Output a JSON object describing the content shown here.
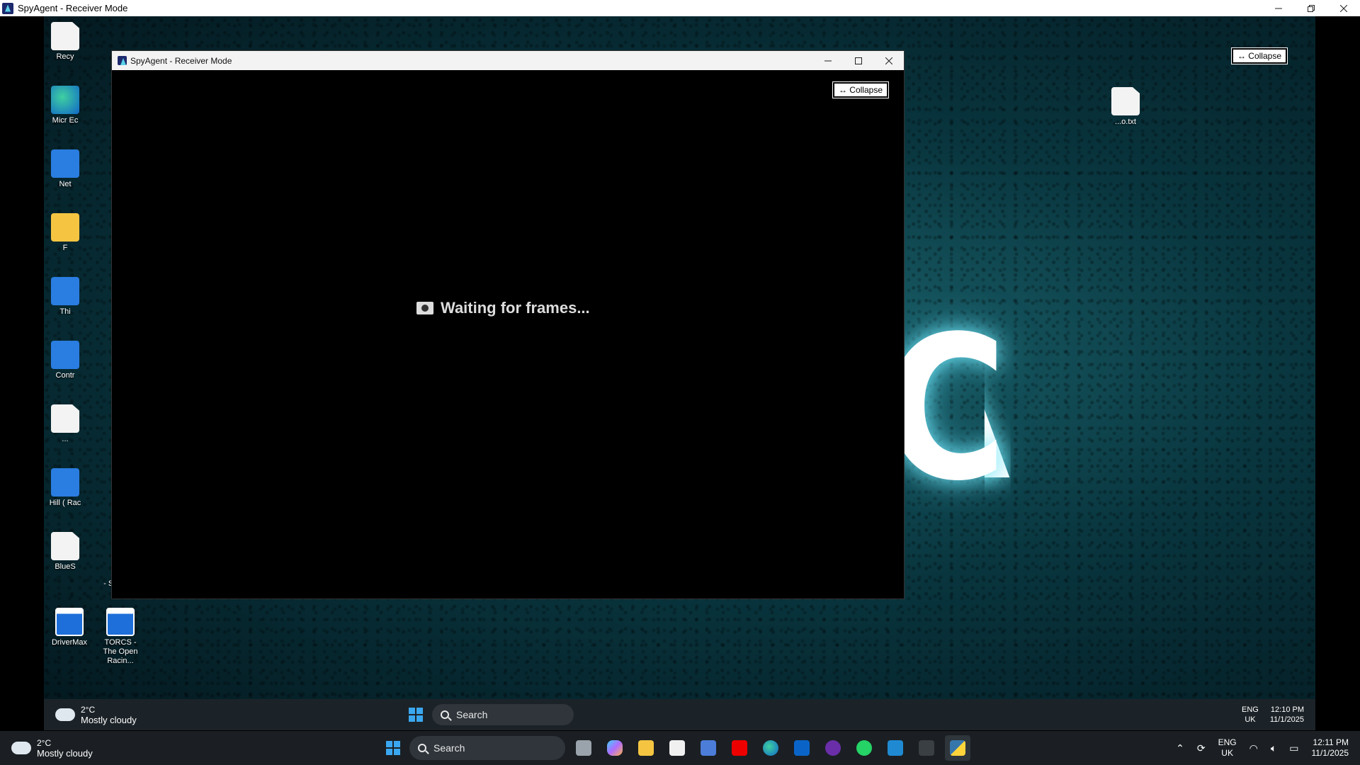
{
  "outer_window": {
    "title": "SpyAgent - Receiver Mode",
    "controls": {
      "minimize": "—",
      "restore": "❐",
      "close": "✕"
    }
  },
  "remote_desktop": {
    "icons": [
      {
        "label": "Recy"
      },
      {
        "label": "Micr Ec"
      },
      {
        "label": "Net"
      },
      {
        "label": "F"
      },
      {
        "label": "Thi"
      },
      {
        "label": "Contr"
      },
      {
        "label": "..."
      },
      {
        "label": "Hill ( Rac"
      },
      {
        "label": "BlueS"
      },
      {
        "label": "...o.txt"
      },
      {
        "label": "- Shortcut"
      },
      {
        "label": "DriverMax"
      },
      {
        "label": "TORCS - The Open Racin..."
      }
    ],
    "wallpaper_text": "AC",
    "collapse_label": "↔ Collapse",
    "taskbar": {
      "temp": "2°C",
      "condition": "Mostly cloudy",
      "search": "Search",
      "lang": "ENG",
      "region": "UK",
      "time": "12:10 PM",
      "date": "11/1/2025"
    }
  },
  "inner_window": {
    "title": "SpyAgent - Receiver Mode",
    "collapse_label": "↔ Collapse",
    "status": "Waiting for frames..."
  },
  "taskbar": {
    "temp": "2°C",
    "condition": "Mostly cloudy",
    "search": "Search",
    "lang": "ENG",
    "region": "UK",
    "time": "12:11 PM",
    "date": "11/1/2025",
    "pinned_icons": [
      "task-view-icon",
      "copilot-icon",
      "file-explorer-icon",
      "store-icon",
      "settings-app-icon",
      "santander-icon",
      "edge-icon",
      "outlook-icon",
      "bt-icon",
      "whatsapp-icon",
      "vscode-icon",
      "terminal-icon",
      "python-icon"
    ]
  },
  "colors": {
    "accent": "#3aa7f0",
    "wallpaper_glow": "#1e6e78",
    "taskbar": "#1b1f23"
  }
}
